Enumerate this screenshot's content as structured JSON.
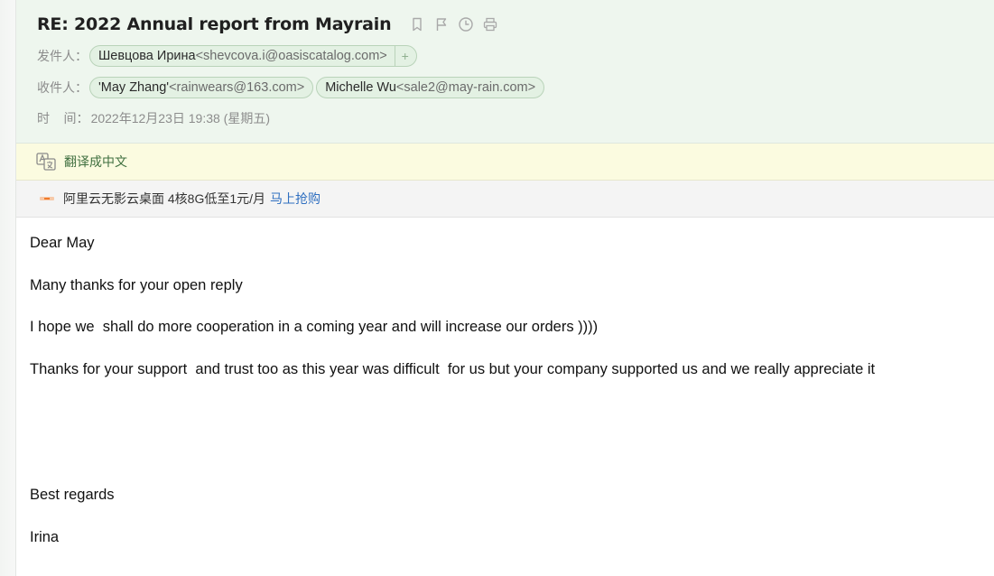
{
  "email": {
    "subject": "RE: 2022 Annual report from Mayrain",
    "from_label": "发件人：",
    "from": {
      "name": "Шевцова Ирина",
      "address": "<shevcova.i@oasiscatalog.com>",
      "add_symbol": "+"
    },
    "to_label": "收件人：",
    "to": [
      {
        "name": "'May Zhang'",
        "address": "<rainwears@163.com>"
      },
      {
        "name": "Michelle Wu",
        "address": "<sale2@may-rain.com>"
      }
    ],
    "time_label": "时    间：",
    "time_value": "2022年12月23日 19:38 (星期五)"
  },
  "toolbar": {
    "icons": [
      "bookmark-icon",
      "flag-icon",
      "clock-icon",
      "print-icon"
    ]
  },
  "translate": {
    "label": "翻译成中文",
    "icon": "translate-icon"
  },
  "ad": {
    "text": "阿里云无影云桌面 4核8G低至1元/月",
    "link": "马上抢购",
    "icon": "ad-icon"
  },
  "body": {
    "greeting": "Dear May",
    "line1": "Many thanks for your open reply",
    "line2": "I hope we  shall do more cooperation in a coming year and will increase our orders ))))",
    "line3": "Thanks for your support  and trust too as this year was difficult  for us but your company supported us and we really appreciate it",
    "closing": "Best regards",
    "signature": "Irina"
  },
  "colors": {
    "header_bg": "#eef6ee",
    "chip_bg": "#e3f1e3",
    "chip_border": "#b9d3b9",
    "translate_bg": "#fbfbe0",
    "link": "#2f6fc0"
  }
}
